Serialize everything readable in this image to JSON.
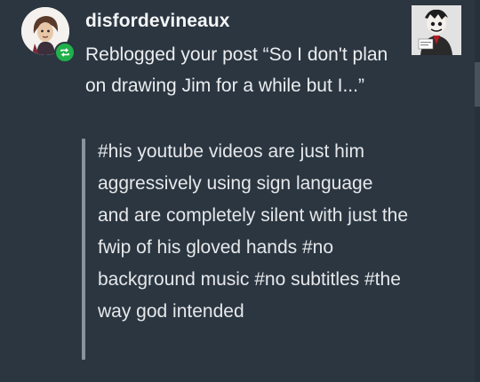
{
  "notification": {
    "username": "disfordevineaux",
    "message": "Reblogged your post “So I don't plan on drawing Jim for a while but I...”",
    "tags": "#his youtube videos are just him aggressively using sign language and are completely silent with just the fwip of his gloved hands #no background music #no subtitles #the way god intended",
    "avatar_icon": "user-avatar",
    "badge_icon": "reblog-icon",
    "thumbnail_icon": "post-thumbnail"
  },
  "colors": {
    "background": "#2b3641",
    "reblog_badge": "#21b04b",
    "quote_bar": "#8a939d"
  }
}
